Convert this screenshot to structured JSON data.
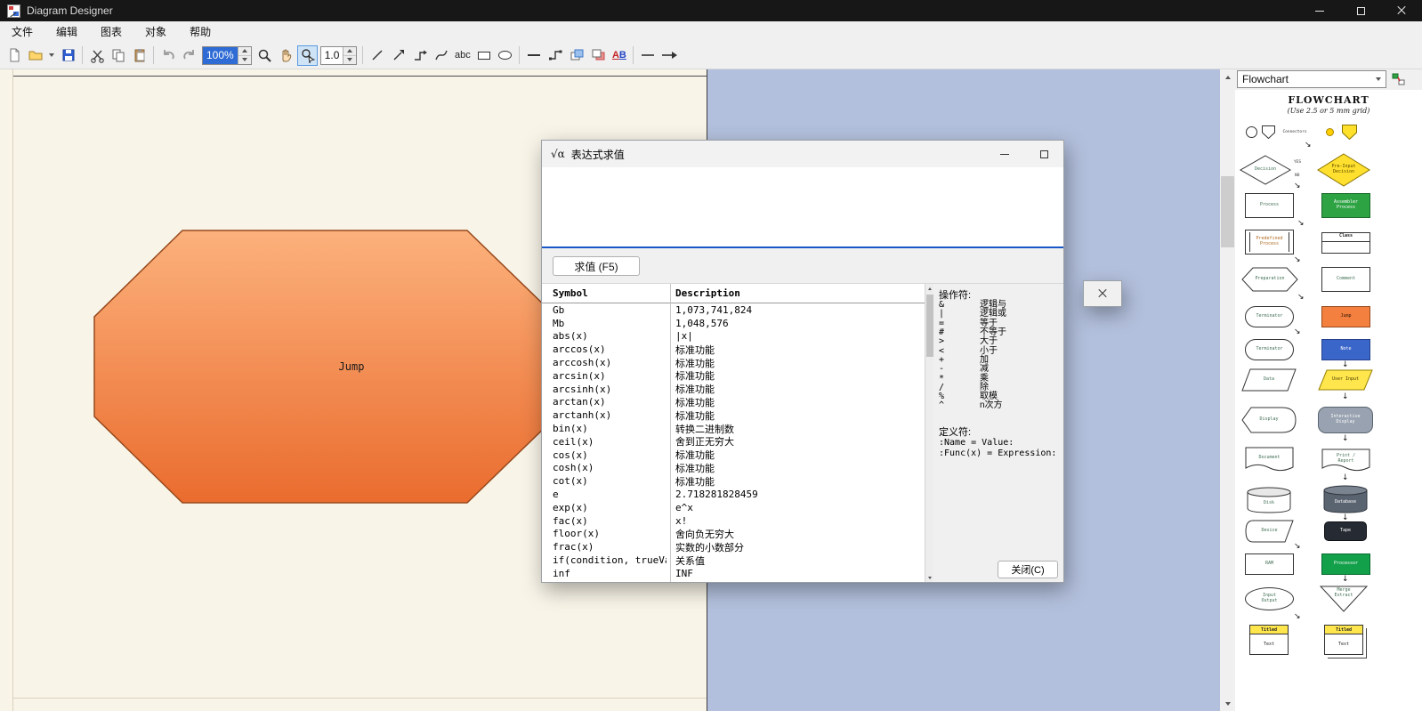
{
  "window": {
    "title": "Diagram Designer"
  },
  "menu": {
    "items": [
      "文件",
      "编辑",
      "图表",
      "对象",
      "帮助"
    ]
  },
  "toolbar": {
    "zoom_value": "100%",
    "line_width_value": "1.0",
    "text_tool_label": "abc",
    "ab_label_a": "A",
    "ab_label_b": "B"
  },
  "canvas": {
    "shape_label": "Jump"
  },
  "icons": {
    "arrow_down": "↓",
    "arrow_down_right": "↘"
  },
  "dialog": {
    "title": "表达式求值",
    "icon": "√α",
    "evaluate_button": "求值 (F5)",
    "close_button": "关闭(C)",
    "table": {
      "columns": [
        "Symbol",
        "Description"
      ],
      "rows": [
        {
          "sym": "Gb",
          "desc": "1,073,741,824"
        },
        {
          "sym": "Mb",
          "desc": "1,048,576"
        },
        {
          "sym": "abs(x)",
          "desc": "|x|"
        },
        {
          "sym": "arccos(x)",
          "desc": "标准功能"
        },
        {
          "sym": "arccosh(x)",
          "desc": "标准功能"
        },
        {
          "sym": "arcsin(x)",
          "desc": "标准功能"
        },
        {
          "sym": "arcsinh(x)",
          "desc": "标准功能"
        },
        {
          "sym": "arctan(x)",
          "desc": "标准功能"
        },
        {
          "sym": "arctanh(x)",
          "desc": "标准功能"
        },
        {
          "sym": "bin(x)",
          "desc": "转换二进制数"
        },
        {
          "sym": "ceil(x)",
          "desc": "舍到正无穷大"
        },
        {
          "sym": "cos(x)",
          "desc": "标准功能"
        },
        {
          "sym": "cosh(x)",
          "desc": "标准功能"
        },
        {
          "sym": "cot(x)",
          "desc": "标准功能"
        },
        {
          "sym": "e",
          "desc": "2.718281828459"
        },
        {
          "sym": "exp(x)",
          "desc": "e^x"
        },
        {
          "sym": "fac(x)",
          "desc": "x!"
        },
        {
          "sym": "floor(x)",
          "desc": "舍向负无穷大"
        },
        {
          "sym": "frac(x)",
          "desc": "实数的小数部分"
        },
        {
          "sym": "if(condition, trueVal...",
          "desc": "关系值"
        },
        {
          "sym": "inf",
          "desc": "INF"
        }
      ]
    },
    "operators_title": "操作符:",
    "operators": [
      {
        "sym": "&",
        "desc": "逻辑与"
      },
      {
        "sym": "|",
        "desc": "逻辑或"
      },
      {
        "sym": "=",
        "desc": "等于"
      },
      {
        "sym": "#",
        "desc": "不等于"
      },
      {
        "sym": ">",
        "desc": "大于"
      },
      {
        "sym": "<",
        "desc": "小于"
      },
      {
        "sym": "+",
        "desc": "加"
      },
      {
        "sym": "-",
        "desc": "减"
      },
      {
        "sym": "*",
        "desc": "乘"
      },
      {
        "sym": "/",
        "desc": "除"
      },
      {
        "sym": "%",
        "desc": "取模"
      },
      {
        "sym": "^",
        "desc": "n次方"
      }
    ],
    "definitions_title": "定义符:",
    "definitions": [
      ":Name = Value:",
      ":Func(x) = Expression:"
    ]
  },
  "panel": {
    "selector_value": "Flowchart",
    "palette": {
      "title": "FLOWCHART",
      "subtitle": "(Use 2.5 or 5 mm grid)",
      "labels": {
        "connectors": "Connectors",
        "decision": "Decision",
        "yes": "YES",
        "no": "NO",
        "pre_input_decision": "Pre-Input Decision",
        "process": "Process",
        "assembler_process": "Assembler Process",
        "predefined_process": "Predefined Process",
        "class": "Class",
        "preparation": "Preparation",
        "comment": "Comment",
        "terminator": "Terminator",
        "jump": "Jump",
        "note": "Note",
        "data": "Data",
        "user_input": "User Input",
        "display": "Display",
        "interactive_display": "Interactive Display",
        "document": "Document",
        "print_report": "Print / Report",
        "disk": "Disk",
        "database": "Database",
        "device": "Device",
        "tape": "Tape",
        "ram": "RAM",
        "processor": "Processor",
        "input_output": "Input Output",
        "merge_extract": "Merge Extract",
        "titled_text_title": "Titled",
        "titled_text_body": "Text"
      }
    }
  },
  "colors": {
    "selection_blue": "#2e6bd4",
    "canvas_bg": "#b3c0dd",
    "page_bg": "#f8f4e8",
    "shape_orange_top": "#fcb17c",
    "shape_orange_bottom": "#ea6c2e",
    "dialog_accent_line": "#1857c8"
  }
}
